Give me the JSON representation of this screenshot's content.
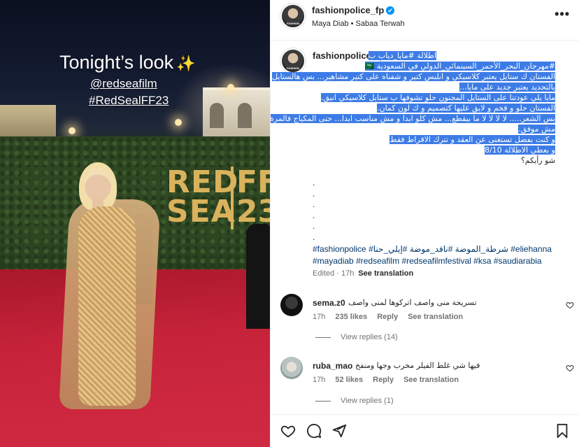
{
  "media": {
    "story_title": "Tonight’s look",
    "story_handle": "@redseafilm",
    "story_tag": "#RedSealFF23",
    "wall_text_line1": "RED",
    "wall_text_line2": "SEA",
    "wall_ff_line1": "FF",
    "wall_ff_line2": "23"
  },
  "header": {
    "username": "fashionpolice_fp",
    "verified": "✔",
    "subtitle": "Maya Diab • Sabaa Terwah",
    "more": "•••"
  },
  "caption": {
    "username": "fashionpolice_fp",
    "verified": "✔",
    "lines": [
      "اطلالة #مايا_دياب ب",
      "#مهرجان_البحر_الأحمر_السينمائي_الدولي في السعودية 🇸🇦",
      "الفستان ك ستايل يعتبر كلاسيكي و انلبس كتير و شفناه على كتير مشاهير... بس هالستايل",
      "بالتحديد يعتبر جديد على مايا...",
      "مايا يلي عودتنا على الستايل المجنون حلو تشوفها ب ستايل كلاسيكي انيق.",
      "الفستان حلو و فخم و لايق عليها كتصميم و ك لون كمان.",
      "بس الشعر..... لا لا لا لا ما بيقطع... مش كلو ابدا و مش مناسب ابدا... حتى المكياج فالمرة",
      "مش موفق.",
      "و كنت بفضل تستغنى عن العقد و تترك الاقراط فقط",
      "و بعطي الاطلالة 8/10",
      "شو رأيكم؟"
    ],
    "dots": [
      ".",
      ".",
      ".",
      ".",
      ".",
      "."
    ],
    "hashtags": [
      "#eliehanna",
      "#إيلي_حنا",
      "#ناقد_موضة",
      "#شرطة_الموضة",
      "#fashionpolice",
      "#mayadiab",
      "#redseafilm",
      "#redseafilmfestival",
      "#ksa",
      "#saudiarabia"
    ],
    "edited": "Edited · 17h",
    "see_translation": "See translation"
  },
  "comments": [
    {
      "username": "sema.z0",
      "text": "تسريحة منى واصف اتركوها لمنى واصف",
      "time": "17h",
      "likes": "235 likes",
      "reply": "Reply",
      "see_translation": "See translation",
      "view_replies": "View replies (14)"
    },
    {
      "username": "ruba_mao",
      "text": "فيها شي غلط الفيلر مخرب وجها ومنفخ",
      "time": "17h",
      "likes": "52 likes",
      "reply": "Reply",
      "see_translation": "See translation",
      "view_replies": "View replies (1)"
    }
  ],
  "icons": {
    "like": "heart-icon",
    "comment": "comment-icon",
    "share": "share-icon",
    "save": "bookmark-icon"
  },
  "colors": {
    "link": "#00376b",
    "verified": "#0095f6",
    "selection": "#3d7ce6"
  }
}
